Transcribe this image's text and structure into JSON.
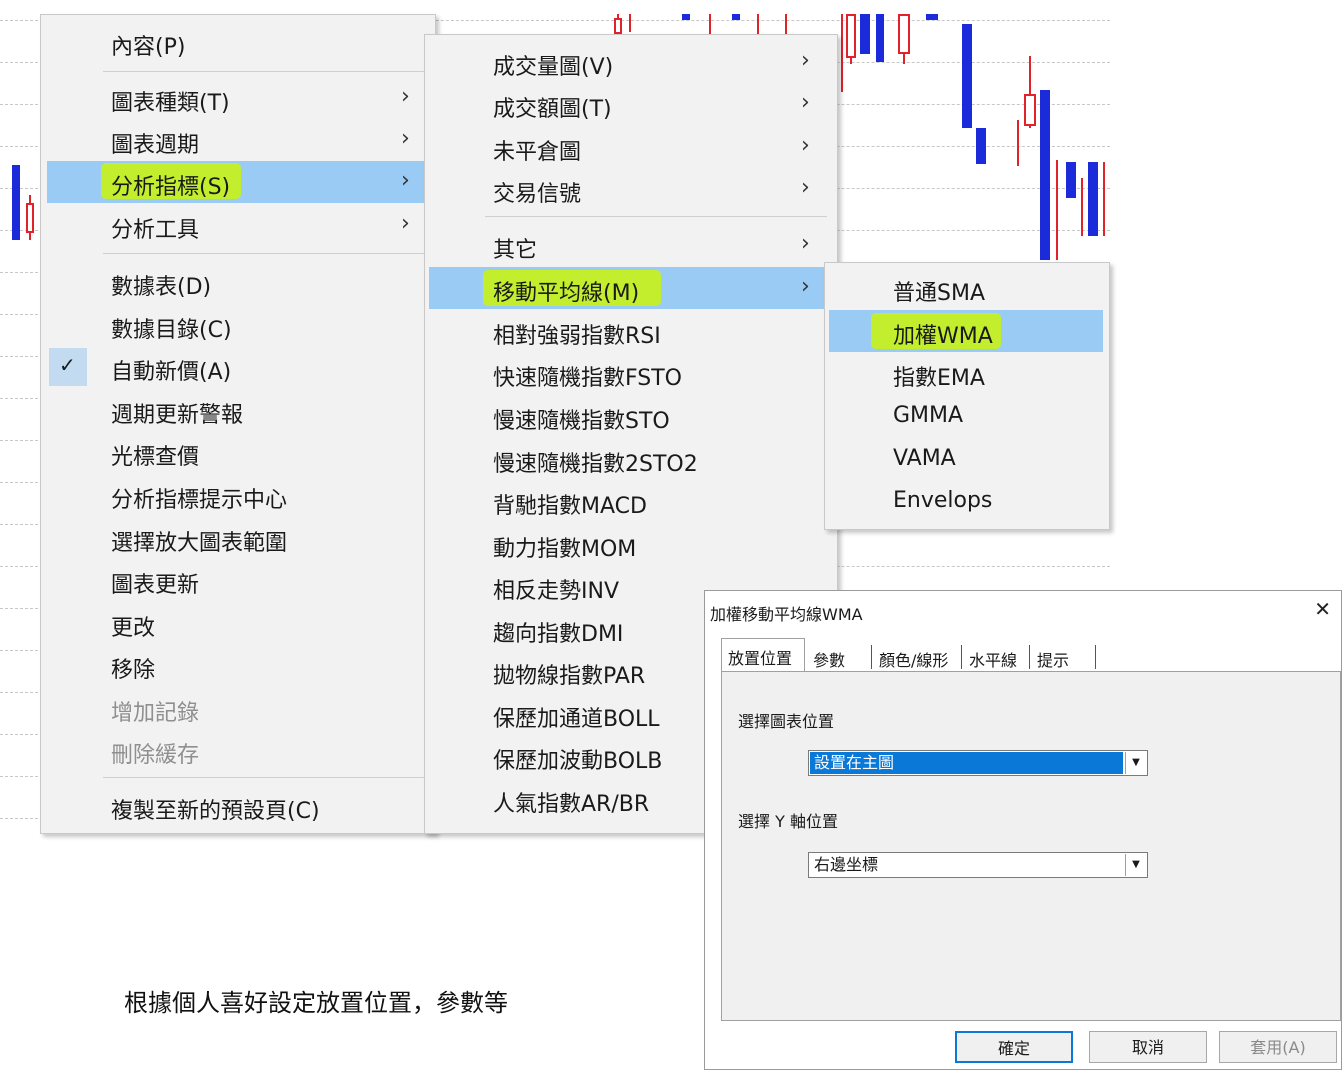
{
  "context_menu": {
    "items": [
      {
        "label": "內容(P)",
        "arrow": "",
        "state": "normal"
      },
      {
        "label": "圖表種類(T)",
        "arrow": "›",
        "state": "normal"
      },
      {
        "label": "圖表週期",
        "arrow": "›",
        "state": "normal"
      },
      {
        "label": "分析指標(S)",
        "arrow": "›",
        "state": "highlighted"
      },
      {
        "label": "分析工具",
        "arrow": "›",
        "state": "normal"
      },
      {
        "label": "數據表(D)",
        "arrow": "",
        "state": "normal"
      },
      {
        "label": "數據目錄(C)",
        "arrow": "",
        "state": "normal"
      },
      {
        "label": "自動新價(A)",
        "arrow": "",
        "state": "checked"
      },
      {
        "label": "週期更新警報",
        "arrow": "",
        "state": "normal"
      },
      {
        "label": "光標查價",
        "arrow": "",
        "state": "normal"
      },
      {
        "label": "分析指標提示中心",
        "arrow": "",
        "state": "normal"
      },
      {
        "label": "選擇放大圖表範圍",
        "arrow": "",
        "state": "normal"
      },
      {
        "label": "圖表更新",
        "arrow": "",
        "state": "normal"
      },
      {
        "label": "更改",
        "arrow": "",
        "state": "normal"
      },
      {
        "label": "移除",
        "arrow": "",
        "state": "normal"
      },
      {
        "label": "增加記錄",
        "arrow": "",
        "state": "disabled"
      },
      {
        "label": "刪除緩存",
        "arrow": "",
        "state": "disabled"
      },
      {
        "label": "複製至新的預設頁(C)",
        "arrow": "",
        "state": "normal"
      }
    ],
    "check_glyph": "✓"
  },
  "indicator_submenu": {
    "items": [
      {
        "label": "成交量圖(V)",
        "arrow": "›",
        "state": "normal"
      },
      {
        "label": "成交額圖(T)",
        "arrow": "›",
        "state": "normal"
      },
      {
        "label": "未平倉圖",
        "arrow": "›",
        "state": "normal"
      },
      {
        "label": "交易信號",
        "arrow": "›",
        "state": "normal"
      },
      {
        "label": "其它",
        "arrow": "›",
        "state": "normal"
      },
      {
        "label": "移動平均線(M)",
        "arrow": "›",
        "state": "highlighted"
      },
      {
        "label": "相對強弱指數RSI",
        "arrow": "",
        "state": "normal"
      },
      {
        "label": "快速隨機指數FSTO",
        "arrow": "",
        "state": "normal"
      },
      {
        "label": "慢速隨機指數STO",
        "arrow": "",
        "state": "normal"
      },
      {
        "label": "慢速隨機指數2STO2",
        "arrow": "",
        "state": "normal"
      },
      {
        "label": "背馳指數MACD",
        "arrow": "",
        "state": "normal"
      },
      {
        "label": "動力指數MOM",
        "arrow": "",
        "state": "normal"
      },
      {
        "label": "相反走勢INV",
        "arrow": "",
        "state": "normal"
      },
      {
        "label": "趨向指數DMI",
        "arrow": "",
        "state": "normal"
      },
      {
        "label": "拋物線指數PAR",
        "arrow": "",
        "state": "normal"
      },
      {
        "label": "保歷加通道BOLL",
        "arrow": "",
        "state": "normal"
      },
      {
        "label": "保歷加波動BOLB",
        "arrow": "",
        "state": "normal"
      },
      {
        "label": "人氣指數AR/BR",
        "arrow": "",
        "state": "normal"
      }
    ]
  },
  "ma_submenu": {
    "items": [
      {
        "label": "普通SMA",
        "state": "normal"
      },
      {
        "label": "加權WMA",
        "state": "highlighted"
      },
      {
        "label": "指數EMA",
        "state": "normal"
      },
      {
        "label": "GMMA",
        "state": "normal"
      },
      {
        "label": "VAMA",
        "state": "normal"
      },
      {
        "label": "Envelops",
        "state": "normal"
      }
    ]
  },
  "dialog": {
    "title": "加權移動平均線WMA",
    "close_glyph": "✕",
    "tabs": [
      "放置位置",
      "參數",
      "顏色/線形",
      "水平線",
      "提示"
    ],
    "active_tab": "放置位置",
    "chart_position_label": "選擇圖表位置",
    "chart_position_value": "設置在主圖",
    "y_axis_label": "選擇 Y 軸位置",
    "y_axis_value": "右邊坐標",
    "dropdown_glyph": "▼",
    "buttons": {
      "ok": "確定",
      "cancel": "取消",
      "apply": "套用(A)"
    }
  },
  "caption": "根據個人喜好設定放置位置，參數等",
  "colors": {
    "highlight": "#99cbf4",
    "marker": "#c9f40a",
    "candle_up": "#e0222b",
    "candle_down": "#1b2bd9",
    "combo_selection": "#0a78d7"
  }
}
